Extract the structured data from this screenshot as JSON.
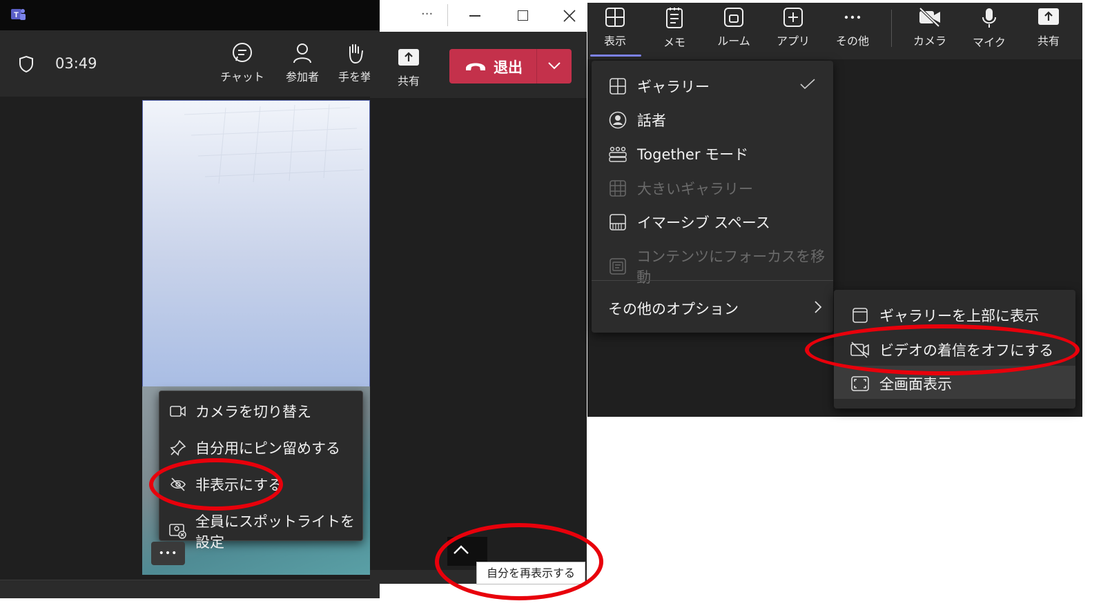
{
  "left": {
    "timer": "03:49",
    "toolbar": [
      {
        "label": "チャット",
        "icon": "chat-icon"
      },
      {
        "label": "参加者",
        "icon": "people-icon"
      },
      {
        "label": "手を挙",
        "icon": "raise-hand-icon"
      }
    ],
    "context_menu": [
      {
        "label": "カメラを切り替え",
        "icon": "camera-icon"
      },
      {
        "label": "自分用にピン留めする",
        "icon": "pin-icon"
      },
      {
        "label": "非表示にする",
        "icon": "hide-icon"
      },
      {
        "label": "全員にスポットライトを設定",
        "icon": "spotlight-icon"
      }
    ],
    "more_button": "•••"
  },
  "middle": {
    "window_dots": "···",
    "share_label": "共有",
    "leave_label": "退出",
    "tooltip": "自分を再表示する"
  },
  "right": {
    "toolbar": [
      {
        "label": "表示",
        "icon": "grid-icon",
        "active": true
      },
      {
        "label": "メモ",
        "icon": "notes-icon"
      },
      {
        "label": "ルーム",
        "icon": "rooms-icon"
      },
      {
        "label": "アプリ",
        "icon": "apps-icon"
      },
      {
        "label": "その他",
        "icon": "more-icon"
      },
      {
        "label": "カメラ",
        "icon": "camera-off-icon"
      },
      {
        "label": "マイク",
        "icon": "mic-icon"
      },
      {
        "label": "共有",
        "icon": "share-icon"
      }
    ],
    "view_menu": [
      {
        "label": "ギャラリー",
        "icon": "gallery-icon",
        "checked": true,
        "disabled": false
      },
      {
        "label": "話者",
        "icon": "speaker-icon",
        "disabled": false
      },
      {
        "label": "Together モード",
        "icon": "together-icon",
        "disabled": false
      },
      {
        "label": "大きいギャラリー",
        "icon": "large-gallery-icon",
        "disabled": true
      },
      {
        "label": "イマーシブ スペース",
        "icon": "immersive-icon",
        "disabled": false
      },
      {
        "label": "コンテンツにフォーカスを移動",
        "icon": "focus-icon",
        "disabled": true
      }
    ],
    "more_options": "その他のオプション",
    "submenu": [
      {
        "label": "ギャラリーを上部に表示",
        "icon": "gallery-top-icon"
      },
      {
        "label": "ビデオの着信をオフにする",
        "icon": "video-off-icon"
      },
      {
        "label": "全画面表示",
        "icon": "fullscreen-icon"
      }
    ]
  },
  "colors": {
    "accent": "#7f85f5",
    "leave_red": "#c4314b",
    "annotation_red": "#e8000b"
  }
}
